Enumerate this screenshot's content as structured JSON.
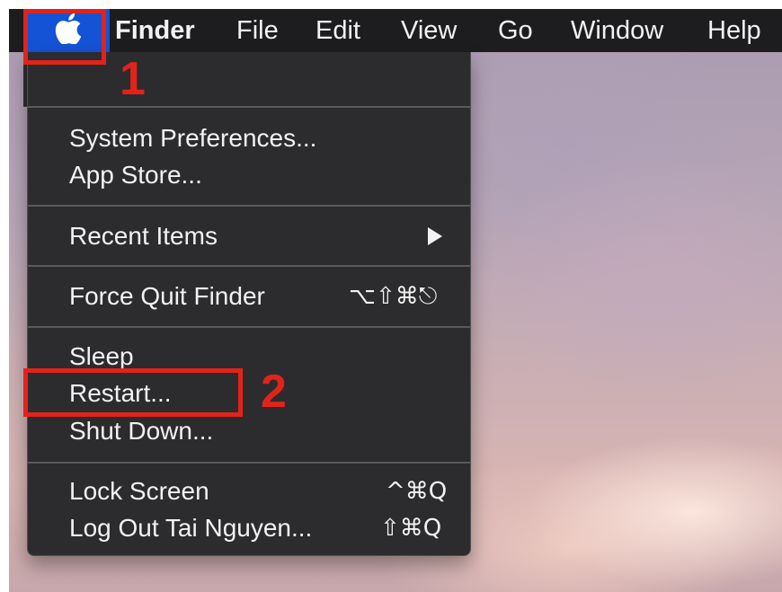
{
  "menubar": {
    "apple_menu_icon": "apple-logo-icon",
    "apple_menu_highlight_color": "#1553d6",
    "items": [
      {
        "label": "Finder"
      },
      {
        "label": "File"
      },
      {
        "label": "Edit"
      },
      {
        "label": "View"
      },
      {
        "label": "Go"
      },
      {
        "label": "Window"
      },
      {
        "label": "Help"
      }
    ]
  },
  "apple_menu": {
    "groups": [
      [
        {
          "label": "System Preferences...",
          "shortcut": ""
        },
        {
          "label": "App Store...",
          "shortcut": ""
        }
      ],
      [
        {
          "label": "Recent Items",
          "submenu": true
        }
      ],
      [
        {
          "label": "Force Quit Finder",
          "shortcut": "⌥⇧⌘⎋"
        }
      ],
      [
        {
          "label": "Sleep"
        },
        {
          "label": "Restart..."
        },
        {
          "label": "Shut Down..."
        }
      ],
      [
        {
          "label": "Lock Screen",
          "shortcut": "^⌘Q"
        },
        {
          "label": "Log Out Tai Nguyen...",
          "shortcut": "⇧⌘Q"
        }
      ]
    ]
  },
  "annotations": {
    "step1": "1",
    "step2": "2",
    "color": "#e2231a"
  }
}
